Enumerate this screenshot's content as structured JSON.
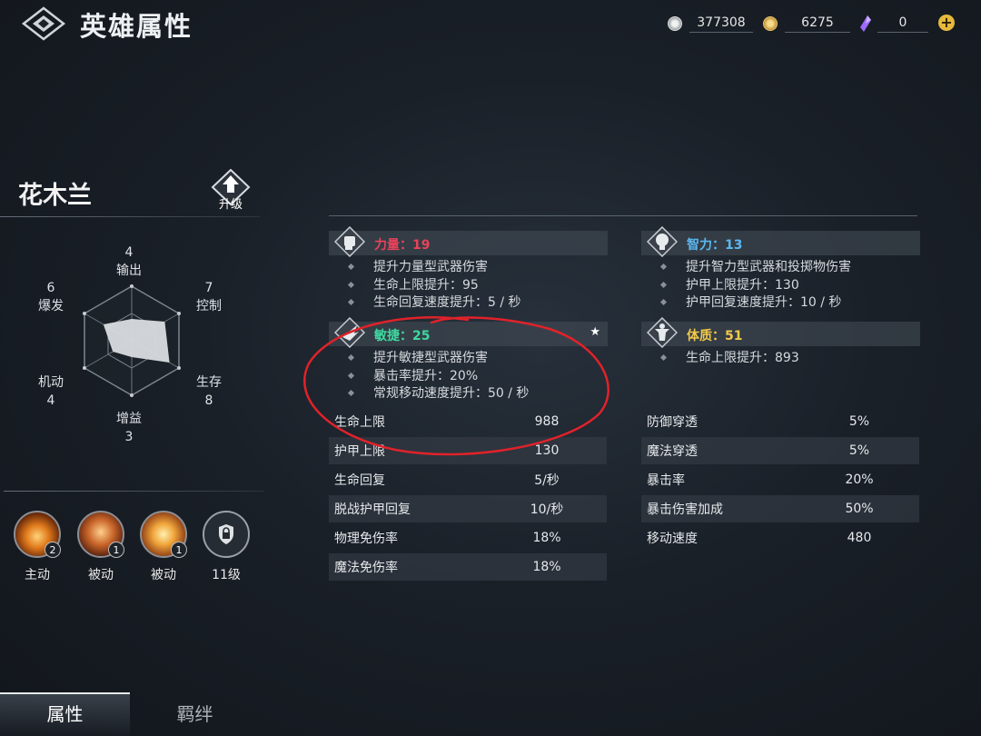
{
  "header": {
    "title": "英雄属性",
    "currencies": [
      {
        "icon": "silver-coin-icon",
        "value": "377308"
      },
      {
        "icon": "gold-coin-icon",
        "value": "6275"
      },
      {
        "icon": "purple-crystal-icon",
        "value": "0"
      }
    ],
    "add_icon": "plus-icon"
  },
  "hero": {
    "name": "花木兰",
    "upgrade_label": "升级"
  },
  "radar": {
    "axes": [
      {
        "label": "输出",
        "value": "4"
      },
      {
        "label": "控制",
        "value": "7"
      },
      {
        "label": "生存",
        "value": "8"
      },
      {
        "label": "增益",
        "value": "3"
      },
      {
        "label": "机动",
        "value": "4"
      },
      {
        "label": "爆发",
        "value": "6"
      }
    ],
    "max": 10
  },
  "skills": [
    {
      "label": "主动",
      "badge": "2",
      "icon": "vortex-skill-icon"
    },
    {
      "label": "被动",
      "badge": "1",
      "icon": "warrior-skill-icon"
    },
    {
      "label": "被动",
      "badge": "1",
      "icon": "crown-skill-icon"
    },
    {
      "label": "11级",
      "badge": "",
      "icon": "lock-shield-icon"
    }
  ],
  "attributes": {
    "strength": {
      "title": "力量：19",
      "color": "#e8425a",
      "lines": [
        "提升力量型武器伤害",
        "生命上限提升：95",
        "生命回复速度提升：5 / 秒"
      ]
    },
    "intellect": {
      "title": "智力：13",
      "color": "#5bb8f0",
      "lines": [
        "提升智力型武器和投掷物伤害",
        "护甲上限提升：130",
        "护甲回复速度提升：10 / 秒"
      ]
    },
    "agility": {
      "title": "敏捷：25",
      "color": "#3fd9a0",
      "lines": [
        "提升敏捷型武器伤害",
        "暴击率提升：20%",
        "常规移动速度提升：50 / 秒"
      ]
    },
    "constitution": {
      "title": "体质：51",
      "color": "#f2c94c",
      "lines": [
        "生命上限提升：893"
      ]
    }
  },
  "stats_left": [
    {
      "name": "生命上限",
      "value": "988"
    },
    {
      "name": "护甲上限",
      "value": "130"
    },
    {
      "name": "生命回复",
      "value": "5/秒"
    },
    {
      "name": "脱战护甲回复",
      "value": "10/秒"
    },
    {
      "name": "物理免伤率",
      "value": "18%"
    },
    {
      "name": "魔法免伤率",
      "value": "18%"
    }
  ],
  "stats_right": [
    {
      "name": "防御穿透",
      "value": "5%"
    },
    {
      "name": "魔法穿透",
      "value": "5%"
    },
    {
      "name": "暴击率",
      "value": "20%"
    },
    {
      "name": "暴击伤害加成",
      "value": "50%"
    },
    {
      "name": "移动速度",
      "value": "480"
    }
  ],
  "tabs": [
    {
      "label": "属性",
      "active": true
    },
    {
      "label": "羁绊",
      "active": false
    }
  ]
}
